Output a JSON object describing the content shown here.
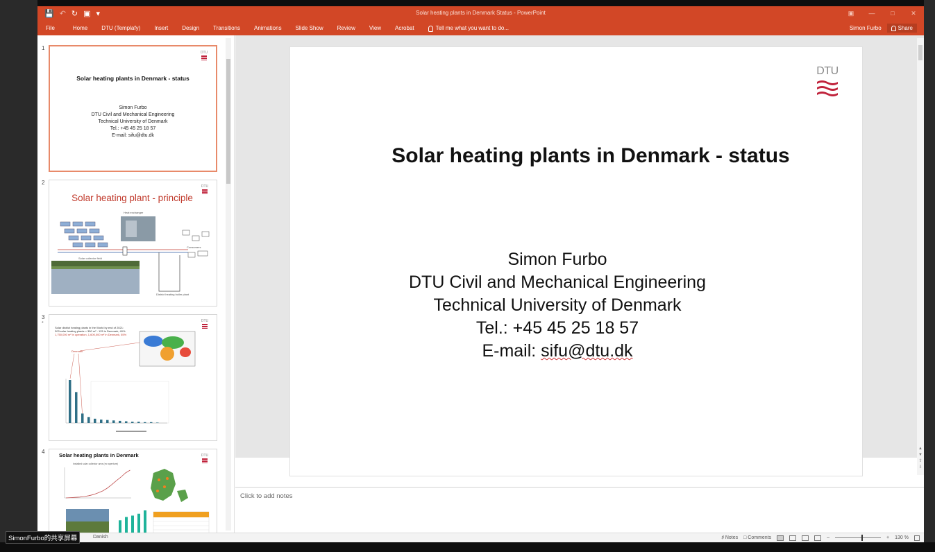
{
  "window": {
    "title": "Solar heating plants in Denmark Status - PowerPoint"
  },
  "ribbon": {
    "tabs": [
      "File",
      "Home",
      "DTU (Templafy)",
      "Insert",
      "Design",
      "Transitions",
      "Animations",
      "Slide Show",
      "Review",
      "View",
      "Acrobat"
    ],
    "tell_me": "Tell me what you want to do...",
    "user": "Simon Furbo",
    "share": "Share"
  },
  "thumbnails": [
    {
      "number": "1",
      "title": "Solar heating plants in Denmark - status",
      "lines": [
        "Simon Furbo",
        "DTU Civil and Mechanical Engineering",
        "Technical University of Denmark",
        "Tel.: +45 45 25 18 57",
        "E-mail: sifu@dtu.dk"
      ],
      "selected": true
    },
    {
      "number": "2",
      "title": "Solar heating plant - principle",
      "labels": [
        "Heat exchanger",
        "Solar collector field",
        "Consumers",
        "District heating boiler plant"
      ]
    },
    {
      "number": "3",
      "star": "*",
      "heading": [
        "Solar district heating plants in the World by end of 2021:",
        "303 solar heating plants > 350 m² - 125 in Denmark, 40%",
        "1,750,000 m² in operation, 1,600,000 m² in Denmark, 55%"
      ],
      "callout": "Denmark",
      "bar_values": [
        100,
        72,
        22,
        14,
        10,
        8,
        7,
        6,
        5,
        4,
        3,
        3,
        2,
        2,
        1
      ]
    },
    {
      "number": "4",
      "title": "Solar heating plants in Denmark",
      "subtitle": "Installed solar collector area (m² aperture)",
      "line_values": [
        0,
        1,
        2,
        3,
        5,
        8,
        12,
        18,
        25,
        35,
        48,
        62,
        75,
        90,
        100
      ],
      "bar_values": [
        58,
        72,
        78,
        86,
        100
      ]
    }
  ],
  "slide": {
    "title": "Solar heating plants in Denmark - status",
    "name": "Simon Furbo",
    "dept": "DTU Civil and Mechanical Engineering",
    "university": "Technical University of Denmark",
    "tel": "Tel.: +45 45 25 18 57",
    "email_label": "E-mail: ",
    "email": "sifu@dtu.dk",
    "logo_text": "DTU"
  },
  "notes": {
    "placeholder": "Click to add notes"
  },
  "statusbar": {
    "language": "Danish",
    "notes": "Notes",
    "comments": "Comments",
    "zoom": "130 %"
  },
  "overlay": {
    "screen_share_label": "SimonFurbo的共享屏幕"
  },
  "colors": {
    "accent": "#d24726",
    "dtu_red": "#c0223b"
  }
}
